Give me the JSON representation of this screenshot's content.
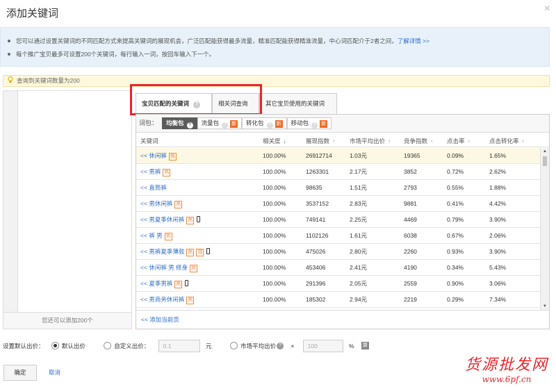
{
  "dialog": {
    "title": "添加关键词",
    "close_glyph": "×"
  },
  "notice": {
    "line1": "您可以通过设置关键词的不同匹配方式来提高关键词的展现机会，广泛匹配能获得最多流量，精准匹配能获得精准流量，中心词匹配介于2者之间，",
    "line1_link": "了解详情 >>",
    "line2": "每个推广宝贝最多可设置200个关键词，每行输入一词，按回车输入下一个。"
  },
  "hint": {
    "text": "查询到关键词数量为200",
    "icon": "lightbulb-icon"
  },
  "left_panel": {
    "footer": "您还可以添加200个"
  },
  "tabs": [
    {
      "label": "宝贝匹配的关键词",
      "active": true,
      "help": "?"
    },
    {
      "label": "相关词查询",
      "active": false
    },
    {
      "label": "其它宝贝使用的关键词",
      "active": false
    }
  ],
  "packages": {
    "label": "词包：",
    "items": [
      {
        "label": "均衡包",
        "active": true,
        "help": "?"
      },
      {
        "label": "流量包",
        "help": "?",
        "tag": "新"
      },
      {
        "label": "转化包",
        "help": "?",
        "tag": "新"
      },
      {
        "label": "移动包",
        "help": "?",
        "tag": "新"
      }
    ]
  },
  "table": {
    "headers": [
      {
        "label": "关键词",
        "sort": ""
      },
      {
        "label": "相关度",
        "sort": "↓"
      },
      {
        "label": "展现指数",
        "sort": "↑"
      },
      {
        "label": "市场平均出价",
        "sort": "↑"
      },
      {
        "label": "竞争指数",
        "sort": "↑"
      },
      {
        "label": "点击率",
        "sort": "↑"
      },
      {
        "label": "点击转化率",
        "sort": "↑"
      }
    ],
    "add_prefix": "<<",
    "rows": [
      {
        "keyword": "休闲裤",
        "tags": [
          "热"
        ],
        "mobile": false,
        "relevance": "100.00%",
        "impressions": "26912714",
        "avg_bid": "1.03元",
        "competition": "19365",
        "ctr": "0.09%",
        "cvr": "1.65%",
        "highlight": true
      },
      {
        "keyword": "男裤",
        "tags": [
          "热"
        ],
        "mobile": false,
        "relevance": "100.00%",
        "impressions": "1263301",
        "avg_bid": "2.17元",
        "competition": "3852",
        "ctr": "0.72%",
        "cvr": "2.62%"
      },
      {
        "keyword": "直筒裤",
        "tags": [],
        "mobile": false,
        "relevance": "100.00%",
        "impressions": "98635",
        "avg_bid": "1.51元",
        "competition": "2793",
        "ctr": "0.55%",
        "cvr": "1.88%"
      },
      {
        "keyword": "男休闲裤",
        "tags": [
          "热"
        ],
        "mobile": false,
        "relevance": "100.00%",
        "impressions": "3537152",
        "avg_bid": "2.83元",
        "competition": "9881",
        "ctr": "0.41%",
        "cvr": "4.42%"
      },
      {
        "keyword": "男夏季休闲裤",
        "tags": [
          "热"
        ],
        "mobile": true,
        "relevance": "100.00%",
        "impressions": "749141",
        "avg_bid": "2.25元",
        "competition": "4469",
        "ctr": "0.79%",
        "cvr": "3.90%"
      },
      {
        "keyword": "裤 男",
        "tags": [
          "热"
        ],
        "mobile": false,
        "relevance": "100.00%",
        "impressions": "1102126",
        "avg_bid": "1.61元",
        "competition": "6038",
        "ctr": "0.67%",
        "cvr": "2.06%"
      },
      {
        "keyword": "男裤夏季薄款",
        "tags": [
          "热",
          "潜"
        ],
        "mobile": true,
        "relevance": "100.00%",
        "impressions": "475026",
        "avg_bid": "2.80元",
        "competition": "2260",
        "ctr": "0.93%",
        "cvr": "3.90%"
      },
      {
        "keyword": "休闲裤 男 修身",
        "tags": [
          "热"
        ],
        "mobile": false,
        "relevance": "100.00%",
        "impressions": "453406",
        "avg_bid": "2.41元",
        "competition": "4190",
        "ctr": "0.34%",
        "cvr": "5.43%"
      },
      {
        "keyword": "夏季男裤",
        "tags": [
          "热"
        ],
        "mobile": true,
        "relevance": "100.00%",
        "impressions": "291396",
        "avg_bid": "2.05元",
        "competition": "2559",
        "ctr": "0.90%",
        "cvr": "3.06%"
      },
      {
        "keyword": "男商务休闲裤",
        "tags": [
          "热"
        ],
        "mobile": false,
        "relevance": "100.00%",
        "impressions": "185302",
        "avg_bid": "2.94元",
        "competition": "2219",
        "ctr": "0.29%",
        "cvr": "7.34%"
      }
    ],
    "footer_link": "<<  添加当前页"
  },
  "bid": {
    "label": "设置默认出价：",
    "option_default": "默认出价",
    "option_custom": "自定义出价：",
    "custom_value": "0.1",
    "custom_unit": "元",
    "option_market": "市场平均出价",
    "market_help": "?",
    "times": "×",
    "market_value": "100",
    "market_unit": "%",
    "calc_glyph": "算",
    "selected": "default"
  },
  "actions": {
    "confirm": "确定",
    "cancel": "取消"
  },
  "watermark": {
    "line1": "货源批发网",
    "line2": "www.6pf.cn"
  },
  "colors": {
    "link": "#2f6ec5",
    "highlight_box": "#e8262a",
    "tag_hot": "#f08a3e",
    "notice_bg": "#e8f1f9",
    "active_package": "#5b5b5b"
  }
}
